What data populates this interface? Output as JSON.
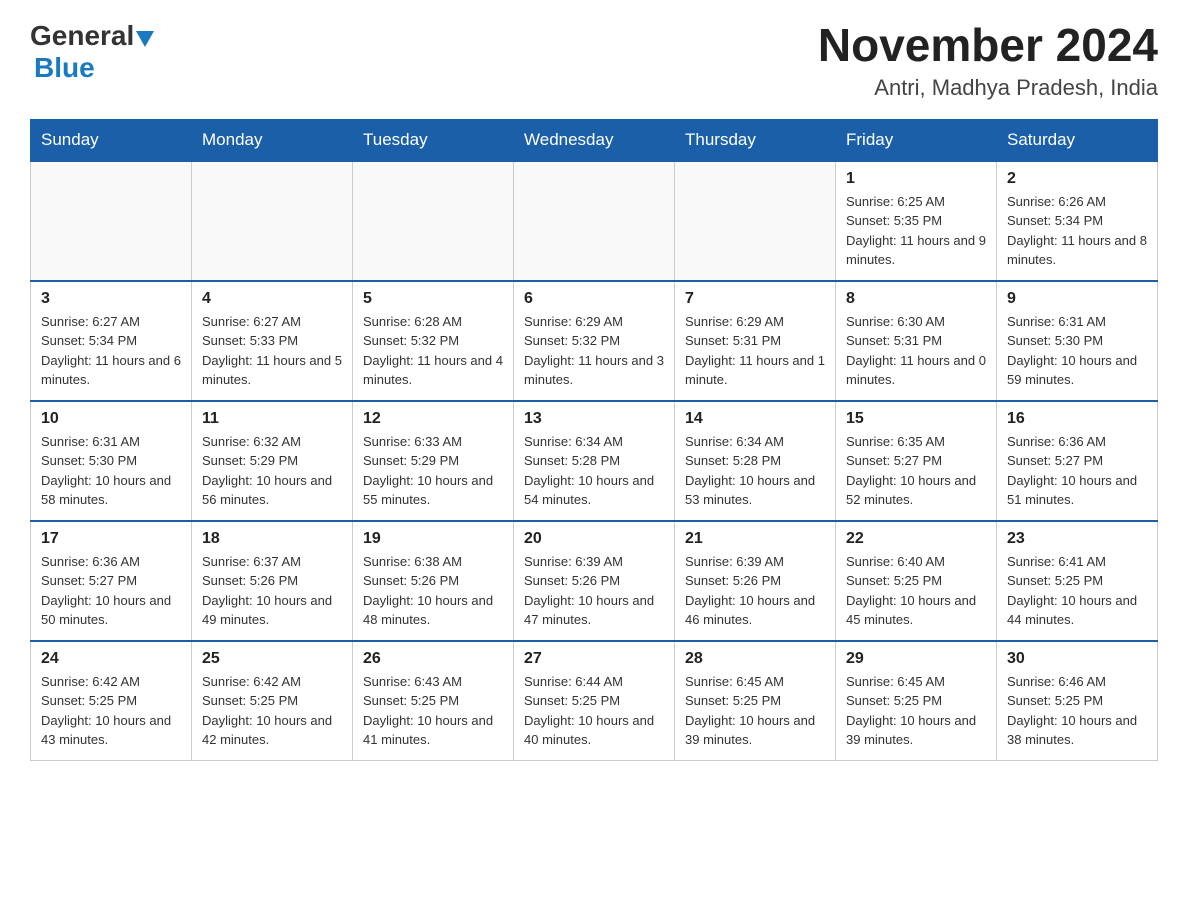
{
  "header": {
    "logo_general": "General",
    "logo_blue": "Blue",
    "title": "November 2024",
    "subtitle": "Antri, Madhya Pradesh, India"
  },
  "days_of_week": [
    "Sunday",
    "Monday",
    "Tuesday",
    "Wednesday",
    "Thursday",
    "Friday",
    "Saturday"
  ],
  "weeks": [
    {
      "days": [
        {
          "num": "",
          "info": ""
        },
        {
          "num": "",
          "info": ""
        },
        {
          "num": "",
          "info": ""
        },
        {
          "num": "",
          "info": ""
        },
        {
          "num": "",
          "info": ""
        },
        {
          "num": "1",
          "info": "Sunrise: 6:25 AM\nSunset: 5:35 PM\nDaylight: 11 hours and 9 minutes."
        },
        {
          "num": "2",
          "info": "Sunrise: 6:26 AM\nSunset: 5:34 PM\nDaylight: 11 hours and 8 minutes."
        }
      ]
    },
    {
      "days": [
        {
          "num": "3",
          "info": "Sunrise: 6:27 AM\nSunset: 5:34 PM\nDaylight: 11 hours and 6 minutes."
        },
        {
          "num": "4",
          "info": "Sunrise: 6:27 AM\nSunset: 5:33 PM\nDaylight: 11 hours and 5 minutes."
        },
        {
          "num": "5",
          "info": "Sunrise: 6:28 AM\nSunset: 5:32 PM\nDaylight: 11 hours and 4 minutes."
        },
        {
          "num": "6",
          "info": "Sunrise: 6:29 AM\nSunset: 5:32 PM\nDaylight: 11 hours and 3 minutes."
        },
        {
          "num": "7",
          "info": "Sunrise: 6:29 AM\nSunset: 5:31 PM\nDaylight: 11 hours and 1 minute."
        },
        {
          "num": "8",
          "info": "Sunrise: 6:30 AM\nSunset: 5:31 PM\nDaylight: 11 hours and 0 minutes."
        },
        {
          "num": "9",
          "info": "Sunrise: 6:31 AM\nSunset: 5:30 PM\nDaylight: 10 hours and 59 minutes."
        }
      ]
    },
    {
      "days": [
        {
          "num": "10",
          "info": "Sunrise: 6:31 AM\nSunset: 5:30 PM\nDaylight: 10 hours and 58 minutes."
        },
        {
          "num": "11",
          "info": "Sunrise: 6:32 AM\nSunset: 5:29 PM\nDaylight: 10 hours and 56 minutes."
        },
        {
          "num": "12",
          "info": "Sunrise: 6:33 AM\nSunset: 5:29 PM\nDaylight: 10 hours and 55 minutes."
        },
        {
          "num": "13",
          "info": "Sunrise: 6:34 AM\nSunset: 5:28 PM\nDaylight: 10 hours and 54 minutes."
        },
        {
          "num": "14",
          "info": "Sunrise: 6:34 AM\nSunset: 5:28 PM\nDaylight: 10 hours and 53 minutes."
        },
        {
          "num": "15",
          "info": "Sunrise: 6:35 AM\nSunset: 5:27 PM\nDaylight: 10 hours and 52 minutes."
        },
        {
          "num": "16",
          "info": "Sunrise: 6:36 AM\nSunset: 5:27 PM\nDaylight: 10 hours and 51 minutes."
        }
      ]
    },
    {
      "days": [
        {
          "num": "17",
          "info": "Sunrise: 6:36 AM\nSunset: 5:27 PM\nDaylight: 10 hours and 50 minutes."
        },
        {
          "num": "18",
          "info": "Sunrise: 6:37 AM\nSunset: 5:26 PM\nDaylight: 10 hours and 49 minutes."
        },
        {
          "num": "19",
          "info": "Sunrise: 6:38 AM\nSunset: 5:26 PM\nDaylight: 10 hours and 48 minutes."
        },
        {
          "num": "20",
          "info": "Sunrise: 6:39 AM\nSunset: 5:26 PM\nDaylight: 10 hours and 47 minutes."
        },
        {
          "num": "21",
          "info": "Sunrise: 6:39 AM\nSunset: 5:26 PM\nDaylight: 10 hours and 46 minutes."
        },
        {
          "num": "22",
          "info": "Sunrise: 6:40 AM\nSunset: 5:25 PM\nDaylight: 10 hours and 45 minutes."
        },
        {
          "num": "23",
          "info": "Sunrise: 6:41 AM\nSunset: 5:25 PM\nDaylight: 10 hours and 44 minutes."
        }
      ]
    },
    {
      "days": [
        {
          "num": "24",
          "info": "Sunrise: 6:42 AM\nSunset: 5:25 PM\nDaylight: 10 hours and 43 minutes."
        },
        {
          "num": "25",
          "info": "Sunrise: 6:42 AM\nSunset: 5:25 PM\nDaylight: 10 hours and 42 minutes."
        },
        {
          "num": "26",
          "info": "Sunrise: 6:43 AM\nSunset: 5:25 PM\nDaylight: 10 hours and 41 minutes."
        },
        {
          "num": "27",
          "info": "Sunrise: 6:44 AM\nSunset: 5:25 PM\nDaylight: 10 hours and 40 minutes."
        },
        {
          "num": "28",
          "info": "Sunrise: 6:45 AM\nSunset: 5:25 PM\nDaylight: 10 hours and 39 minutes."
        },
        {
          "num": "29",
          "info": "Sunrise: 6:45 AM\nSunset: 5:25 PM\nDaylight: 10 hours and 39 minutes."
        },
        {
          "num": "30",
          "info": "Sunrise: 6:46 AM\nSunset: 5:25 PM\nDaylight: 10 hours and 38 minutes."
        }
      ]
    }
  ]
}
